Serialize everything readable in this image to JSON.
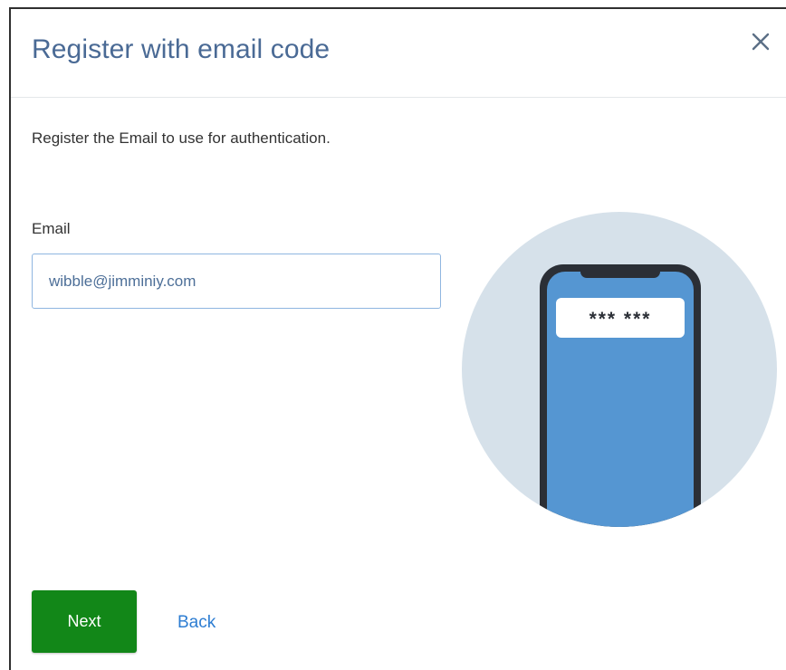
{
  "dialog": {
    "title": "Register with email code",
    "close_icon": "close-icon",
    "description": "Register the Email to use for authentication."
  },
  "form": {
    "email_label": "Email",
    "email_value": "wibble@jimminiy.com"
  },
  "illustration": {
    "icon": "phone-illustration",
    "code_text": "*** ***",
    "colors": {
      "circle": "#d6e1ea",
      "phone_screen": "#5596d2",
      "phone_frame": "#2b2f36"
    }
  },
  "actions": {
    "next_label": "Next",
    "back_label": "Back"
  },
  "colors": {
    "title": "#4a6a95",
    "next_button": "#128718",
    "link": "#2d7dd2",
    "input_border": "#8fb6e0"
  }
}
